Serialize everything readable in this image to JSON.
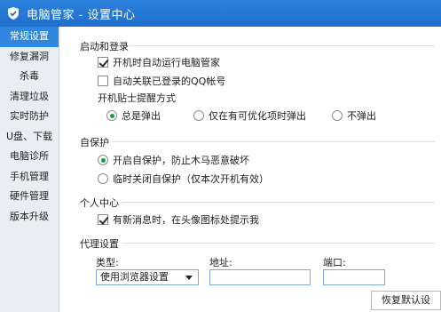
{
  "window": {
    "title": "电脑管家 - 设置中心"
  },
  "sidebar": {
    "items": [
      {
        "label": "常规设置",
        "active": true
      },
      {
        "label": "修复漏洞",
        "active": false
      },
      {
        "label": "杀毒",
        "active": false
      },
      {
        "label": "清理垃圾",
        "active": false
      },
      {
        "label": "实时防护",
        "active": false
      },
      {
        "label": "U盘、下载",
        "active": false
      },
      {
        "label": "电脑诊所",
        "active": false
      },
      {
        "label": "手机管理",
        "active": false
      },
      {
        "label": "硬件管理",
        "active": false
      },
      {
        "label": "版本升级",
        "active": false
      }
    ]
  },
  "startup": {
    "heading": "启动和登录",
    "autorun_label": "开机时自动运行电脑管家",
    "autorun_checked": true,
    "auto_qq_label": "自动关联已登录的QQ帐号",
    "auto_qq_checked": false,
    "tips_heading": "开机贴士提醒方式",
    "tips_options": [
      {
        "label": "总是弹出",
        "selected": true
      },
      {
        "label": "仅在有可优化项时弹出",
        "selected": false
      },
      {
        "label": "不弹出",
        "selected": false
      }
    ]
  },
  "selfprotect": {
    "heading": "自保护",
    "options": [
      {
        "label": "开启自保护，防止木马恶意破坏",
        "selected": true
      },
      {
        "label": "临时关闭自保护（仅本次开机有效）",
        "selected": false
      }
    ]
  },
  "personal": {
    "heading": "个人中心",
    "notify_label": "有新消息时，在头像图标处提示我",
    "notify_checked": true
  },
  "proxy": {
    "heading": "代理设置",
    "type_label": "类型:",
    "type_value": "使用浏览器设置",
    "address_label": "地址:",
    "address_value": "",
    "port_label": "端口:",
    "port_value": ""
  },
  "footer": {
    "restore_label": "恢复默认设置"
  },
  "colors": {
    "titlebar": "#2c82dd",
    "sidebar_active": "#2e86de",
    "radio_selected": "#1f9c3a"
  }
}
